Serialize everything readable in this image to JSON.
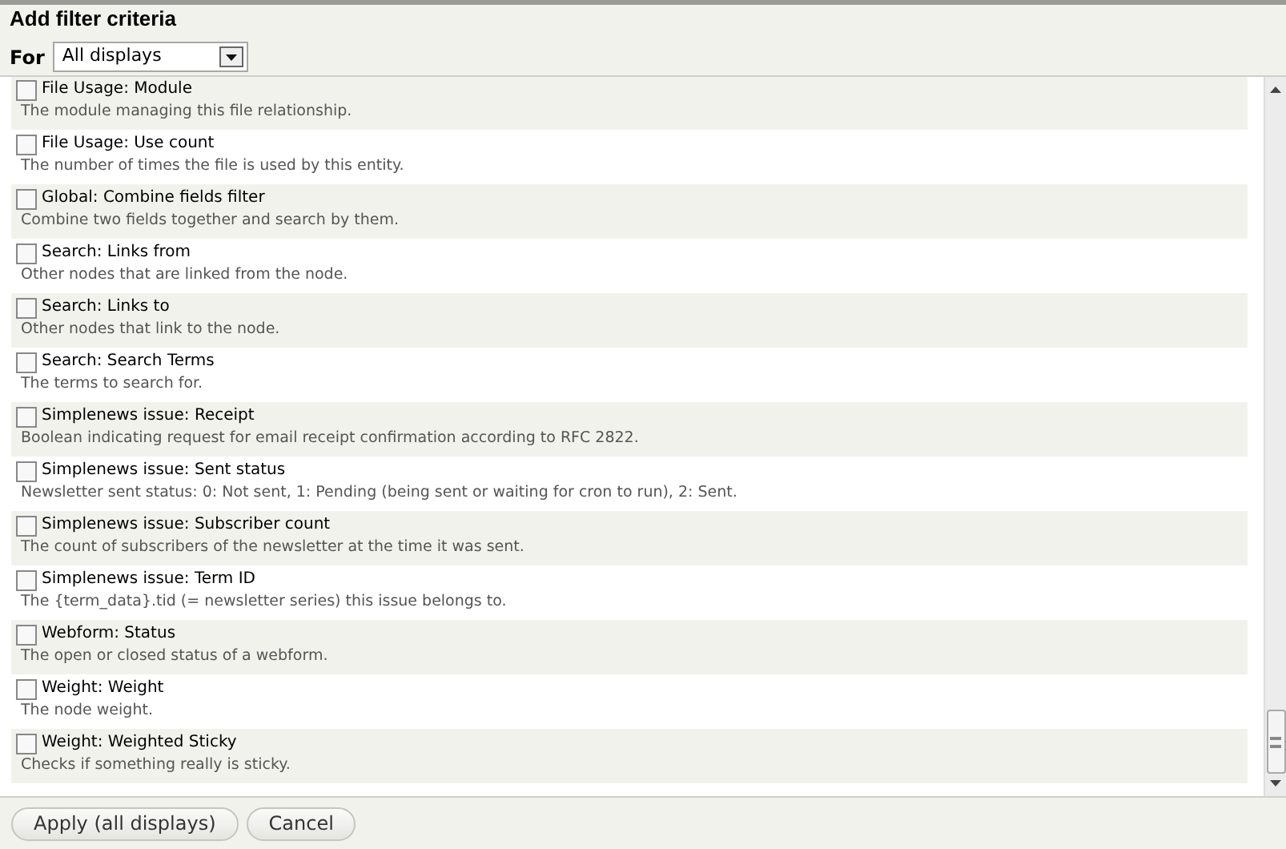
{
  "dialog": {
    "title": "Add filter criteria"
  },
  "for_select": {
    "label": "For",
    "value": "All displays"
  },
  "filters": [
    {
      "title": "File Usage: Module",
      "description": "The module managing this file relationship.",
      "checked": false
    },
    {
      "title": "File Usage: Use count",
      "description": "The number of times the file is used by this entity.",
      "checked": false
    },
    {
      "title": "Global: Combine fields filter",
      "description": "Combine two fields together and search by them.",
      "checked": false
    },
    {
      "title": "Search: Links from",
      "description": "Other nodes that are linked from the node.",
      "checked": false
    },
    {
      "title": "Search: Links to",
      "description": "Other nodes that link to the node.",
      "checked": false
    },
    {
      "title": "Search: Search Terms",
      "description": "The terms to search for.",
      "checked": false
    },
    {
      "title": "Simplenews issue: Receipt",
      "description": "Boolean indicating request for email receipt confirmation according to RFC 2822.",
      "checked": false
    },
    {
      "title": "Simplenews issue: Sent status",
      "description": "Newsletter sent status: 0: Not sent, 1: Pending (being sent or waiting for cron to run), 2: Sent.",
      "checked": false
    },
    {
      "title": "Simplenews issue: Subscriber count",
      "description": "The count of subscribers of the newsletter at the time it was sent.",
      "checked": false
    },
    {
      "title": "Simplenews issue: Term ID",
      "description": "The {term_data}.tid (= newsletter series) this issue belongs to.",
      "checked": false
    },
    {
      "title": "Webform: Status",
      "description": "The open or closed status of a webform.",
      "checked": false
    },
    {
      "title": "Weight: Weight",
      "description": "The node weight.",
      "checked": false
    },
    {
      "title": "Weight: Weighted Sticky",
      "description": "Checks if something really is sticky.",
      "checked": false
    }
  ],
  "buttons": [
    "Apply (all displays)",
    "Cancel"
  ]
}
